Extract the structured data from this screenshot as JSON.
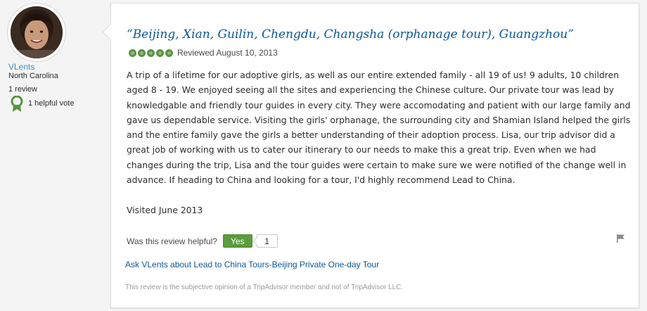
{
  "reviewer": {
    "name": "VLents",
    "location": "North Carolina",
    "review_count": "1 review",
    "helpful_votes": "1 helpful vote"
  },
  "review": {
    "title": "“Beijing, Xian, Guilin, Chengdu, Changsha (orphanage tour), Guangzhou”",
    "rating_bubbles": 5,
    "rating_max": 5,
    "reviewed_date": "Reviewed August 10, 2013",
    "body": "A trip of a lifetime for our adoptive girls, as well as our entire extended family - all 19 of us! 9 adults, 10 children aged 8 - 19. We enjoyed seeing all the sites and experiencing the Chinese culture. Our private tour was lead by knowledgable and friendly tour guides in every city. They were accomodating and patient with our large family and gave us dependable service. Visiting the girls' orphanage, the surrounding city and Shamian Island helped the girls and the entire family gave the girls a better understanding of their adoption process. Lisa, our trip advisor did a great job of working with us to cater our itinerary to our needs to make this a great trip. Even when we had changes during the trip, Lisa and the tour guides were certain to make sure we were notified of the change well in advance. If heading to China and looking for a tour, I'd highly recommend Lead to China.",
    "visited": "Visited June 2013"
  },
  "helpful": {
    "question": "Was this review helpful?",
    "yes_label": "Yes",
    "count": "1"
  },
  "ask_link": "Ask VLents about Lead to China Tours-Beijing Private One-day Tour",
  "disclaimer": "This review is the subjective opinion of a TripAdvisor member and not of TripAdvisor LLC.",
  "icons": {
    "badge": "helpful-votes-badge-icon",
    "flag": "flag-icon",
    "rating": "rating-bubble-icon"
  },
  "colors": {
    "link": "#0a5799",
    "rating_green": "#589442",
    "yes_button": "#5b9c3d"
  }
}
